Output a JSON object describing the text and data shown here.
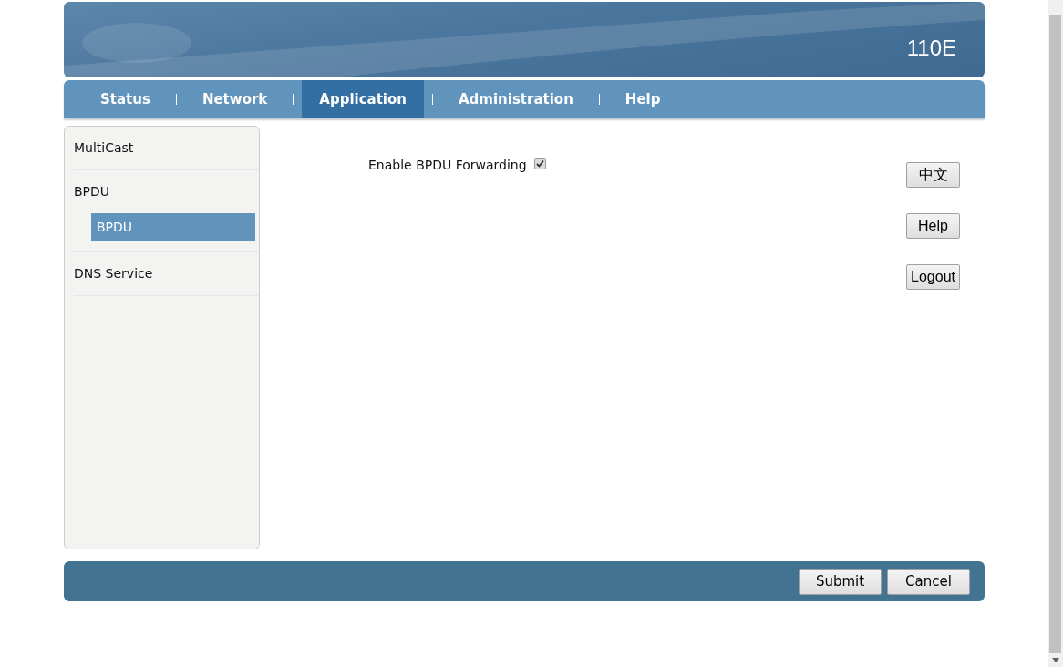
{
  "banner": {
    "model": "110E"
  },
  "tabs": [
    {
      "label": "Status",
      "selected": false
    },
    {
      "label": "Network",
      "selected": false
    },
    {
      "label": "Application",
      "selected": true
    },
    {
      "label": "Administration",
      "selected": false
    },
    {
      "label": "Help",
      "selected": false
    }
  ],
  "sidebar": {
    "items": [
      {
        "label": "MultiCast"
      },
      {
        "label": "BPDU",
        "children": [
          {
            "label": "BPDU",
            "selected": true
          }
        ]
      },
      {
        "label": "DNS Service"
      }
    ]
  },
  "form": {
    "option": {
      "label": "Enable BPDU Forwarding",
      "checked": true
    }
  },
  "side_buttons": [
    "中文",
    "Help",
    "Logout"
  ],
  "footer_buttons": [
    "Submit",
    "Cancel"
  ]
}
